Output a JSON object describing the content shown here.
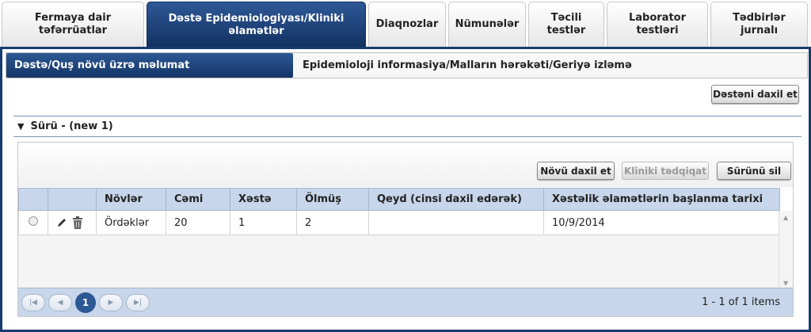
{
  "top_tabs": [
    {
      "label": "Fermaya dair təfərrüatlar"
    },
    {
      "label": "Dəstə Epidemiologiyası/Kliniki əlamətlər"
    },
    {
      "label": "Diaqnozlar"
    },
    {
      "label": "Nümunələr"
    },
    {
      "label": "Təcili testlər"
    },
    {
      "label": "Laborator testləri"
    },
    {
      "label": "Tədbirlər jurnalı"
    }
  ],
  "sub_tabs": {
    "active": "Dəstə/Quş növü üzrə məlumat",
    "other": "Epidemioloji informasiya/Malların hərəkəti/Geriyə izləmə"
  },
  "add_herd_button": "Dəstəni daxil et",
  "section": {
    "arrow": "▼",
    "title": "Sürü - (new 1)"
  },
  "toolbar": {
    "add_species": "Növü daxil et",
    "clinical": "Kliniki tədqiqat",
    "delete_herd": "Sürünü sil"
  },
  "table": {
    "headers": [
      "Növlər",
      "Cəmi",
      "Xəstə",
      "Ölmüş",
      "Qeyd (cinsi daxil edərək)",
      "Xəstəlik əlamətlərin başlanma tarixi"
    ],
    "rows": [
      [
        "Ördəklər",
        "20",
        "1",
        "2",
        "",
        "10/9/2014"
      ]
    ]
  },
  "pager": {
    "page": "1",
    "info": "1 - 1 of 1 items"
  },
  "colors": {
    "accent": "#163b70",
    "header_bg": "#c7d6ea"
  }
}
